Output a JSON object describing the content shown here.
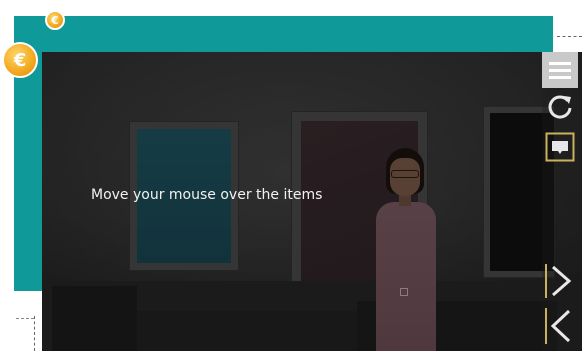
{
  "scene": {
    "instruction": "Move your mouse over the items"
  },
  "badges": {
    "small_symbol": "€",
    "large_symbol": "€"
  },
  "sidebar": {
    "menu_icon": "hamburger-menu-icon",
    "refresh_icon": "refresh-icon",
    "caption_icon": "caption-icon",
    "next_icon": "chevron-right-icon",
    "prev_icon": "chevron-left-icon"
  },
  "colors": {
    "teal_frame": "#0f9a99",
    "coin": "#f2a81d",
    "sidebar_accent": "#c9b25a"
  }
}
